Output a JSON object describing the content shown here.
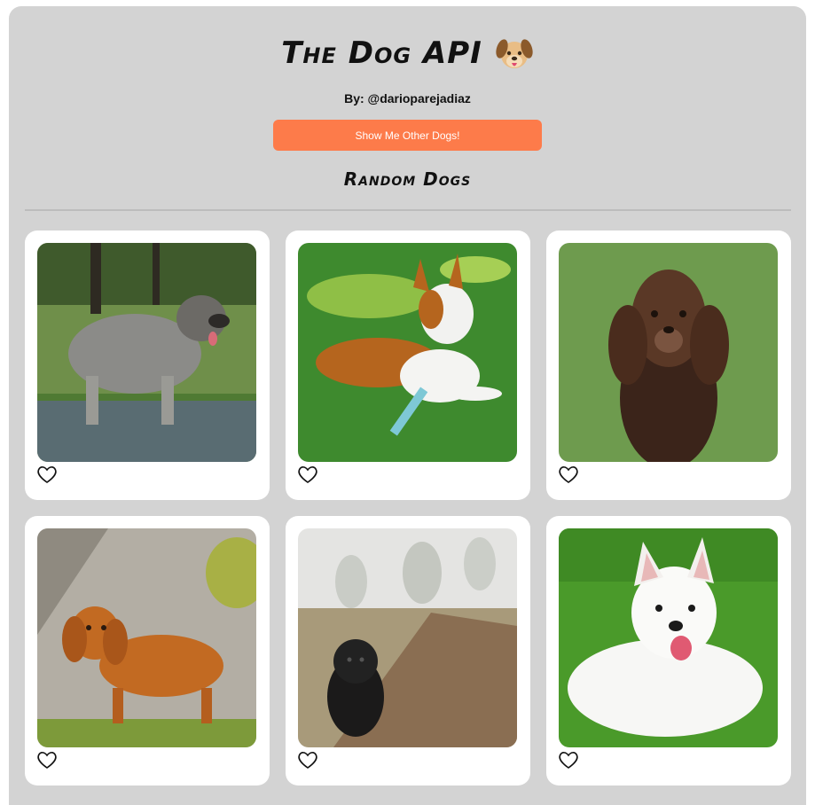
{
  "header": {
    "title": "The Dog API",
    "byline": "By: @darioparejadiaz",
    "button_label": "Show Me Other Dogs!",
    "section_title": "Random Dogs"
  },
  "colors": {
    "panel_bg": "#d3d3d3",
    "button_bg": "#fd7b4a",
    "card_bg": "#ffffff"
  },
  "cards": [
    {
      "photo": "grey fluffy dog standing in water",
      "favorited": false
    },
    {
      "photo": "brown and white bull terrier lying on grass",
      "favorited": false
    },
    {
      "photo": "brown spaniel on green background",
      "favorited": false
    },
    {
      "photo": "golden cocker spaniel on path",
      "favorited": false
    },
    {
      "photo": "black curly dog on foggy trail",
      "favorited": false
    },
    {
      "photo": "white samoyed lying on grass",
      "favorited": false
    }
  ]
}
